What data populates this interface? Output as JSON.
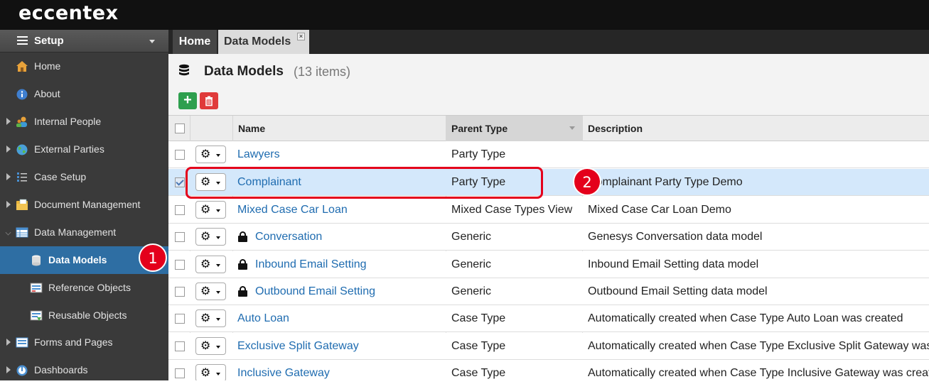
{
  "app": {
    "logo": "eccentex"
  },
  "sidebar": {
    "header": "Setup",
    "items": [
      {
        "label": "Home",
        "icon": "home-icon",
        "expandable": false
      },
      {
        "label": "About",
        "icon": "info-icon",
        "expandable": false
      },
      {
        "label": "Internal People",
        "icon": "people-icon",
        "expandable": true
      },
      {
        "label": "External Parties",
        "icon": "globe-icon",
        "expandable": true
      },
      {
        "label": "Case Setup",
        "icon": "case-setup-icon",
        "expandable": true
      },
      {
        "label": "Document Management",
        "icon": "folder-icon",
        "expandable": true
      },
      {
        "label": "Data Management",
        "icon": "table-icon",
        "expandable": true,
        "expanded": true
      },
      {
        "label": "Data Models",
        "icon": "database-icon",
        "active": true
      },
      {
        "label": "Reference Objects",
        "icon": "reference-icon"
      },
      {
        "label": "Reusable Objects",
        "icon": "reusable-icon"
      },
      {
        "label": "Forms and Pages",
        "icon": "forms-icon",
        "expandable": true
      },
      {
        "label": "Dashboards",
        "icon": "dashboard-icon",
        "expandable": true
      }
    ]
  },
  "tabs": [
    {
      "label": "Home"
    },
    {
      "label": "Data Models",
      "active": true,
      "close": "×"
    }
  ],
  "page": {
    "title": "Data Models",
    "count": "(13 items)"
  },
  "table": {
    "columns": [
      "Name",
      "Parent Type",
      "Description"
    ],
    "rows": [
      {
        "name": "Lawyers",
        "parent": "Party Type",
        "desc": "",
        "locked": false,
        "selected": false
      },
      {
        "name": "Complainant",
        "parent": "Party Type",
        "desc": "Complainant Party Type Demo",
        "locked": false,
        "selected": true
      },
      {
        "name": "Mixed Case Car Loan",
        "parent": "Mixed Case Types View",
        "desc": "Mixed Case Car Loan Demo",
        "locked": false,
        "selected": false
      },
      {
        "name": "Conversation",
        "parent": "Generic",
        "desc": "Genesys Conversation data model",
        "locked": true,
        "selected": false
      },
      {
        "name": "Inbound Email Setting",
        "parent": "Generic",
        "desc": "Inbound Email Setting data model",
        "locked": true,
        "selected": false
      },
      {
        "name": "Outbound Email Setting",
        "parent": "Generic",
        "desc": "Outbound Email Setting data model",
        "locked": true,
        "selected": false
      },
      {
        "name": "Auto Loan",
        "parent": "Case Type",
        "desc": "Automatically created when Case Type Auto Loan was created",
        "locked": false,
        "selected": false
      },
      {
        "name": "Exclusive Split Gateway",
        "parent": "Case Type",
        "desc": "Automatically created when Case Type Exclusive Split Gateway was created",
        "locked": false,
        "selected": false
      },
      {
        "name": "Inclusive Gateway",
        "parent": "Case Type",
        "desc": "Automatically created when Case Type Inclusive Gateway was created",
        "locked": false,
        "selected": false
      }
    ]
  },
  "annotations": {
    "badge1": "1",
    "badge2": "2"
  },
  "colors": {
    "accent": "#2e6ea3",
    "link": "#1f6cb0",
    "annotation": "#e4001b",
    "add": "#2e9f4e",
    "delete": "#e03a3a"
  }
}
